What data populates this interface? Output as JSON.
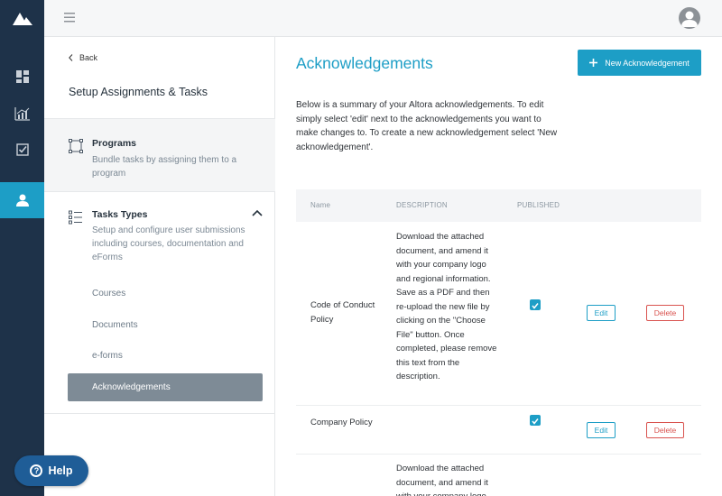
{
  "colors": {
    "rail": "#1e3249",
    "accent": "#1d9ec6",
    "help": "#1f5d97",
    "danger": "#d9534f"
  },
  "rail": {
    "items": [
      "dashboard-icon",
      "chart-icon",
      "checkbox-icon",
      "user-icon"
    ],
    "active": 3
  },
  "subnav": {
    "back_label": "Back",
    "title": "Setup Assignments & Tasks",
    "programs": {
      "title": "Programs",
      "desc": "Bundle tasks by assigning them to a program"
    },
    "tasks": {
      "title": "Tasks Types",
      "desc": "Setup and configure user submissions including courses, documentation and eForms",
      "links": [
        "Courses",
        "Documents",
        "e-forms",
        "Acknowledgements"
      ],
      "active": "Acknowledgements"
    }
  },
  "main": {
    "title": "Acknowledgements",
    "new_button": "New Acknowledgement",
    "intro": "Below is a summary of your Altora acknowledgements. To edit simply select 'edit' next to the acknowledgements you want to make changes to. To create a new acknowledgement select 'New acknowledgement'.",
    "columns": [
      "Name",
      "DESCRIPTION",
      "PUBLISHED"
    ],
    "rows": [
      {
        "name": "Code of Conduct Policy",
        "description": "Download the attached document, and amend it with your company logo and regional information. Save as a PDF and then re-upload the new file by clicking on the \"Choose File\" button. Once completed, please remove this text from the description.",
        "published": true
      },
      {
        "name": "Company Policy",
        "description": "",
        "published": true
      },
      {
        "name": "",
        "description": "Download the attached document, and amend it with your company logo",
        "published": false
      }
    ],
    "edit_label": "Edit",
    "delete_label": "Delete"
  },
  "help_label": "Help"
}
